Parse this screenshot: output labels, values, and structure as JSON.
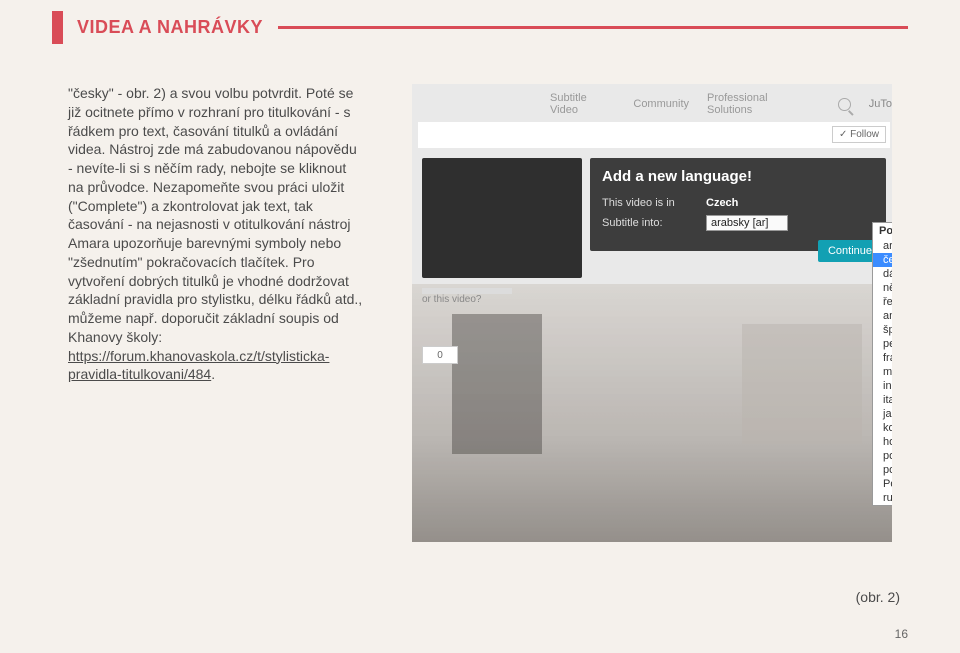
{
  "header": {
    "title": "VIDEA A NAHRÁVKY"
  },
  "main": {
    "paragraph": "\"česky\" - obr. 2) a svou volbu potvrdit. Poté se již ocitnete přímo v rozhraní pro titulkování - s řádkem pro text, časování titulků a ovládání videa. Nástroj zde má zabudovanou nápovědu - nevíte-li si s něčím rady, nebojte se kliknout na průvodce. Nezapomeňte svou práci uložit (\"Complete\") a zkontrolovat jak text, tak časování - na nejasnosti v otitulkování nástroj Amara upozorňuje barevnými symboly nebo \"zšednutím\" pokračovacích tlačítek. Pro vytvoření dobrých titulků je vhodné dodržovat základní pravidla pro stylistku, délku řádků atd., můžeme např. doporučit základní soupis od Khanovy školy: ",
    "link_text": "https://forum.khanovaskola.cz/t/stylisticka-pravidla-titulkovani/484",
    "link_href": "https://forum.khanovaskola.cz/t/stylisticka-pravidla-titulkovani/484",
    "trailing": "."
  },
  "screenshot": {
    "tabs": [
      "Subtitle Video",
      "Community",
      "Professional Solutions"
    ],
    "user": "JuTo",
    "follow": "✓ Follow",
    "dialog": {
      "title": "Add a new language!",
      "video_in_label": "This video is in",
      "video_in_value": "Czech",
      "subtitle_into_label": "Subtitle into:",
      "subtitle_into_value": "arabsky [ar]",
      "continue": "Continue"
    },
    "dropdown": {
      "group": "Popular",
      "options": [
        "arabsky [ar]",
        "česky [cs]",
        "dánsky [da]",
        "německy [de]",
        "řecky [el]",
        "anglicky [en]",
        "španělsky [es]",
        "persky [fa]",
        "francouzsky [fr]",
        "maďarsky [hu]",
        "indonésky [id]",
        "italsky [it]",
        "japonsky [ja]",
        "korejsky [ko]",
        "holandsky [nl]",
        "polsky [pl]",
        "portugalsky [pt]",
        "Portuguese, Brazilian [pt-br]",
        "rumunsky [ro]"
      ],
      "selected": "česky [cs]"
    },
    "like_count": "0",
    "question_hint": "or this video?"
  },
  "caption": "(obr. 2)",
  "page_number": "16"
}
